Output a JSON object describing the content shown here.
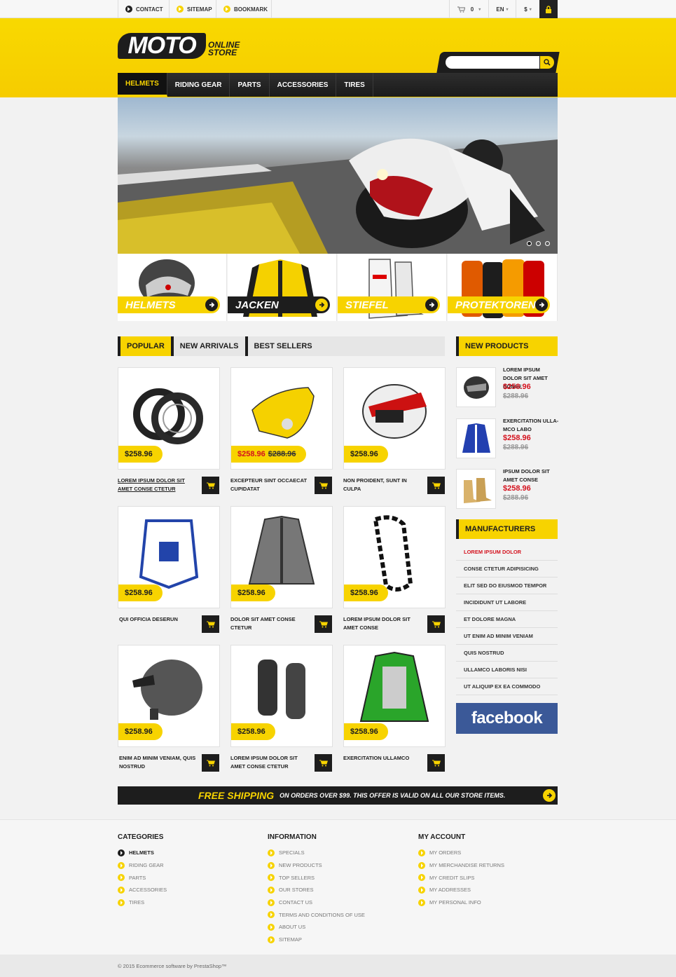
{
  "topbar": {
    "contact": "CONTACT",
    "sitemap": "SITEMAP",
    "bookmark": "BOOKMARK",
    "cart_count": "0",
    "language": "EN",
    "currency": "$"
  },
  "header": {
    "logo_main": "MOTO",
    "logo_sub_1": "ONLINE",
    "logo_sub_2": "STORE",
    "search_placeholder": ""
  },
  "nav": [
    "HELMETS",
    "RIDING GEAR",
    "PARTS",
    "ACCESSORIES",
    "TIRES"
  ],
  "categories": [
    "HELMETS",
    "JACKEN",
    "STIEFEL",
    "PROTEKTOREN"
  ],
  "tabs": [
    "POPULAR",
    "NEW ARRIVALS",
    "BEST SELLERS"
  ],
  "products": [
    {
      "name": "LOREM IPSUM DOLOR SIT AMET CONSE CTETUR",
      "price": "$258.96",
      "old_price": ""
    },
    {
      "name": "EXCEPTEUR SINT OCCAECAT CUPIDATAT",
      "price": "$258.96",
      "old_price": "$288.96"
    },
    {
      "name": "NON PROIDENT, SUNT IN CULPA",
      "price": "$258.96",
      "old_price": ""
    },
    {
      "name": "QUI OFFICIA DESERUN",
      "price": "$258.96",
      "old_price": ""
    },
    {
      "name": "DOLOR SIT AMET CONSE CTETUR",
      "price": "$258.96",
      "old_price": ""
    },
    {
      "name": "LOREM IPSUM DOLOR SIT AMET CONSE",
      "price": "$258.96",
      "old_price": ""
    },
    {
      "name": "ENIM AD MINIM VENIAM, QUIS NOSTRUD",
      "price": "$258.96",
      "old_price": ""
    },
    {
      "name": "LOREM IPSUM DOLOR SIT AMET CONSE CTETUR",
      "price": "$258.96",
      "old_price": ""
    },
    {
      "name": "EXERCITATION ULLAMCO",
      "price": "$258.96",
      "old_price": ""
    }
  ],
  "new_products": {
    "title": "NEW PRODUCTS",
    "items": [
      {
        "name": "LOREM IPSUM DOLOR SIT AMET CONSE",
        "price": "$258.96",
        "old_price": "$288.96"
      },
      {
        "name": "EXERCITATION ULLA-MCO LABO",
        "price": "$258.96",
        "old_price": "$288.96"
      },
      {
        "name": "IPSUM DOLOR SIT AMET CONSE",
        "price": "$258.96",
        "old_price": "$288.96"
      }
    ]
  },
  "manufacturers": {
    "title": "MANUFACTURERS",
    "items": [
      "LOREM IPSUM DOLOR",
      "CONSE CTETUR ADIPISICING",
      "ELIT SED DO EIUSMOD TEMPOR",
      "INCIDIDUNT UT LABORE",
      "ET DOLORE MAGNA",
      "UT ENIM AD MINIM VENIAM",
      "QUIS NOSTRUD",
      "ULLAMCO LABORIS NISI",
      "UT ALIQUIP EX EA COMMODO"
    ]
  },
  "facebook": "facebook",
  "shipping": {
    "big": "FREE SHIPPING",
    "small": "ON ORDERS OVER $99. THIS OFFER IS VALID ON ALL OUR STORE ITEMS."
  },
  "footer": {
    "categories": {
      "title": "CATEGORIES",
      "items": [
        "HELMETS",
        "RIDING GEAR",
        "PARTS",
        "ACCESSORIES",
        "TIRES"
      ]
    },
    "information": {
      "title": "INFORMATION",
      "items": [
        "SPECIALS",
        "NEW PRODUCTS",
        "TOP SELLERS",
        "OUR STORES",
        "CONTACT US",
        "TERMS AND CONDITIONS OF USE",
        "ABOUT US",
        "SITEMAP"
      ]
    },
    "account": {
      "title": "MY ACCOUNT",
      "items": [
        "MY ORDERS",
        "MY MERCHANDISE RETURNS",
        "MY CREDIT SLIPS",
        "MY ADDRESSES",
        "MY PERSONAL INFO"
      ]
    },
    "copyright": "© 2015 Ecommerce software by PrestaShop™"
  },
  "colors": {
    "accent": "#f7d300",
    "dark": "#1d1d1d",
    "sale": "#d4121e",
    "facebook": "#3b5998"
  }
}
